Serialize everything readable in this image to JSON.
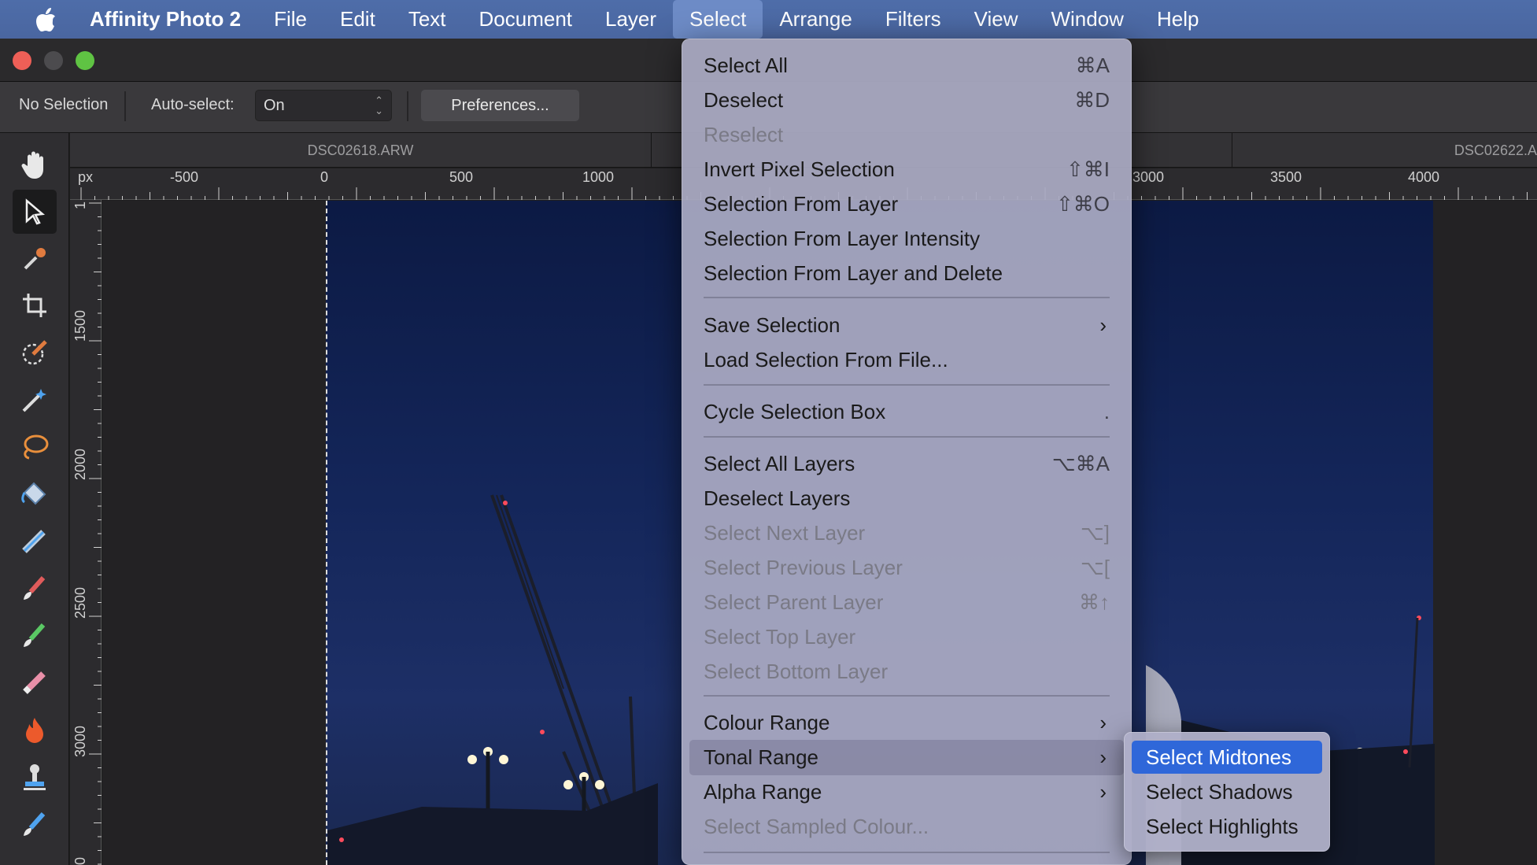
{
  "menubar": {
    "app_name": "Affinity Photo 2",
    "items": [
      "File",
      "Edit",
      "Text",
      "Document",
      "Layer",
      "Select",
      "Arrange",
      "Filters",
      "View",
      "Window",
      "Help"
    ],
    "active_item": "Select"
  },
  "context_toolbar": {
    "selection_status": "No Selection",
    "autoselect_label": "Auto-select:",
    "autoselect_value": "On",
    "preferences_label": "Preferences..."
  },
  "document_tabs": [
    "DSC02618.ARW",
    "DSC02622.A"
  ],
  "ruler": {
    "unit": "px",
    "h_labels": [
      "-500",
      "0",
      "500",
      "1000",
      "3000",
      "3500",
      "4000"
    ],
    "v_labels": [
      "1",
      "1500",
      "2000",
      "2500",
      "3000",
      "0"
    ]
  },
  "tools": [
    "hand-tool",
    "move-tool",
    "color-picker-tool",
    "crop-tool",
    "selection-brush-tool",
    "flood-select-tool",
    "freehand-selection-tool",
    "flood-fill-tool",
    "gradient-tool",
    "paint-brush-tool",
    "pixel-tool",
    "erase-brush-tool",
    "dodge-burn-tool",
    "clone-brush-tool",
    "healing-brush-tool"
  ],
  "select_menu": {
    "items": [
      {
        "label": "Select All",
        "shortcut": "⌘A",
        "disabled": false
      },
      {
        "label": "Deselect",
        "shortcut": "⌘D",
        "disabled": false
      },
      {
        "label": "Reselect",
        "shortcut": "",
        "disabled": true
      },
      {
        "label": "Invert Pixel Selection",
        "shortcut": "⇧⌘I",
        "disabled": false
      },
      {
        "label": "Selection From Layer",
        "shortcut": "⇧⌘O",
        "disabled": false
      },
      {
        "label": "Selection From Layer Intensity",
        "shortcut": "",
        "disabled": false
      },
      {
        "label": "Selection From Layer and Delete",
        "shortcut": "",
        "disabled": false
      },
      {
        "label": "Save Selection",
        "shortcut": "",
        "disabled": false,
        "submenu": true
      },
      {
        "label": "Load Selection From File...",
        "shortcut": "",
        "disabled": false
      },
      {
        "label": "Cycle Selection Box",
        "shortcut": ".",
        "disabled": false
      },
      {
        "label": "Select All Layers",
        "shortcut": "⌥⌘A",
        "disabled": false
      },
      {
        "label": "Deselect Layers",
        "shortcut": "",
        "disabled": false
      },
      {
        "label": "Select Next Layer",
        "shortcut": "⌥]",
        "disabled": true
      },
      {
        "label": "Select Previous Layer",
        "shortcut": "⌥[",
        "disabled": true
      },
      {
        "label": "Select Parent Layer",
        "shortcut": "⌘↑",
        "disabled": true
      },
      {
        "label": "Select Top Layer",
        "shortcut": "",
        "disabled": true
      },
      {
        "label": "Select Bottom Layer",
        "shortcut": "",
        "disabled": true
      },
      {
        "label": "Colour Range",
        "shortcut": "",
        "disabled": false,
        "submenu": true
      },
      {
        "label": "Tonal Range",
        "shortcut": "",
        "disabled": false,
        "submenu": true,
        "highlighted": true
      },
      {
        "label": "Alpha Range",
        "shortcut": "",
        "disabled": false,
        "submenu": true
      },
      {
        "label": "Select Sampled Colour...",
        "shortcut": "",
        "disabled": true
      }
    ]
  },
  "tonal_range_submenu": {
    "items": [
      "Select Midtones",
      "Select Shadows",
      "Select Highlights"
    ],
    "highlighted": "Select Midtones"
  },
  "colors": {
    "menubar": "#4e6da9",
    "highlight": "#2f67d9",
    "canvas": "#232224"
  }
}
